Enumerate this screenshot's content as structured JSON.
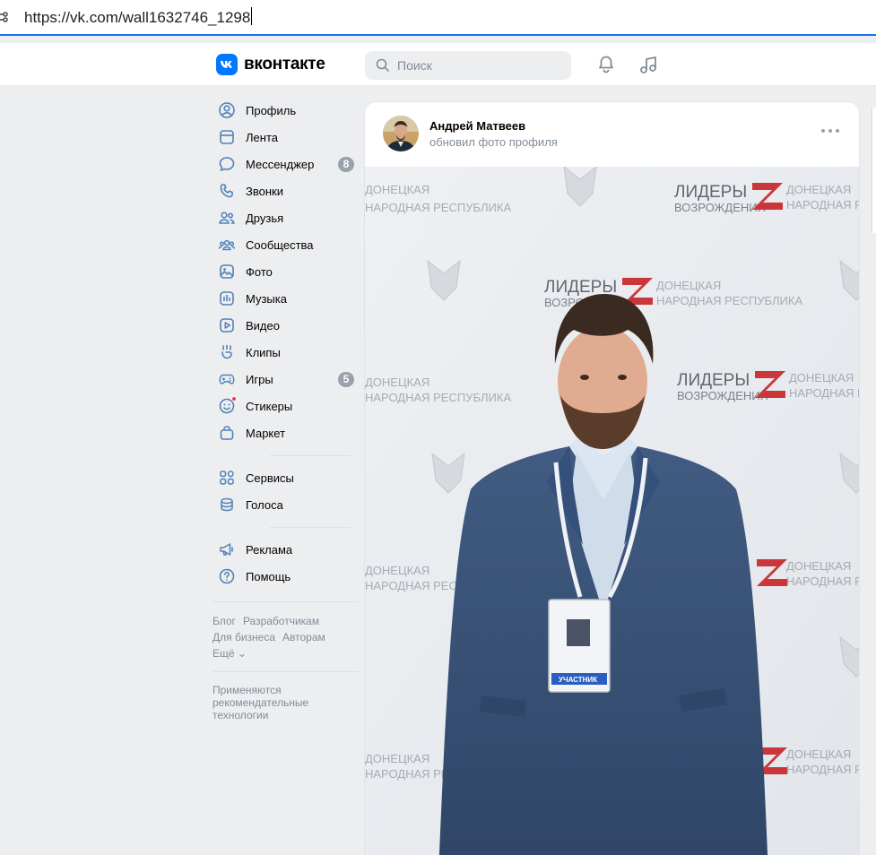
{
  "browser": {
    "url": "https://vk.com/wall1632746_1298"
  },
  "header": {
    "logo_text": "вконтакте",
    "search_placeholder": "Поиск",
    "notifications_icon": "bell-icon",
    "music_icon": "music-note-icon",
    "brand_color": "#0077ff"
  },
  "sidebar": {
    "items": [
      {
        "label": "Профиль",
        "icon": "user-circle-icon"
      },
      {
        "label": "Лента",
        "icon": "newsfeed-icon"
      },
      {
        "label": "Мессенджер",
        "icon": "message-icon",
        "badge": "8"
      },
      {
        "label": "Звонки",
        "icon": "phone-icon"
      },
      {
        "label": "Друзья",
        "icon": "friends-icon"
      },
      {
        "label": "Сообщества",
        "icon": "communities-icon"
      },
      {
        "label": "Фото",
        "icon": "photo-icon"
      },
      {
        "label": "Музыка",
        "icon": "music-icon"
      },
      {
        "label": "Видео",
        "icon": "video-icon"
      },
      {
        "label": "Клипы",
        "icon": "clips-icon"
      },
      {
        "label": "Игры",
        "icon": "gamepad-icon",
        "badge": "5"
      },
      {
        "label": "Стикеры",
        "icon": "sticker-icon"
      },
      {
        "label": "Маркет",
        "icon": "market-bag-icon"
      }
    ],
    "items2": [
      {
        "label": "Сервисы",
        "icon": "services-icon"
      },
      {
        "label": "Голоса",
        "icon": "coins-icon"
      }
    ],
    "items3": [
      {
        "label": "Реклама",
        "icon": "megaphone-icon"
      },
      {
        "label": "Помощь",
        "icon": "help-icon"
      }
    ],
    "footer_links": [
      "Блог",
      "Разработчикам",
      "Для бизнеса",
      "Авторам",
      "Ещё ⌄"
    ],
    "footer_note": "Применяются рекомендательные технологии"
  },
  "post": {
    "author": "Андрей Матвеев",
    "subtitle": "обновил фото профиля",
    "backdrop_texts": [
      "ЛИДЕРЫ",
      "ВОЗРОЖДЕНИЯ",
      "ДОНЕЦКАЯ",
      "НАРОДНАЯ РЕСПУБЛИКА"
    ],
    "badge_text": "УЧАСТНИК"
  }
}
